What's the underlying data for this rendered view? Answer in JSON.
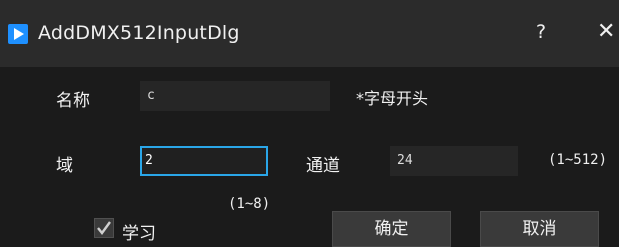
{
  "window": {
    "title": "AddDMX512InputDlg",
    "help_label": "?",
    "close_label": "✕",
    "app_icon": "play-icon"
  },
  "form": {
    "name_label": "名称",
    "name_value": "c",
    "name_hint": "*字母开头",
    "domain_label": "域",
    "domain_value": "2",
    "domain_range": "(1~8)",
    "channel_label": "通道",
    "channel_value": "24",
    "channel_range": "(1~512)",
    "learn_label": "学习",
    "learn_checked": true
  },
  "buttons": {
    "ok_label": "确定",
    "cancel_label": "取消"
  },
  "colors": {
    "accent": "#2aa6e8",
    "app_icon": "#1e90ff"
  }
}
